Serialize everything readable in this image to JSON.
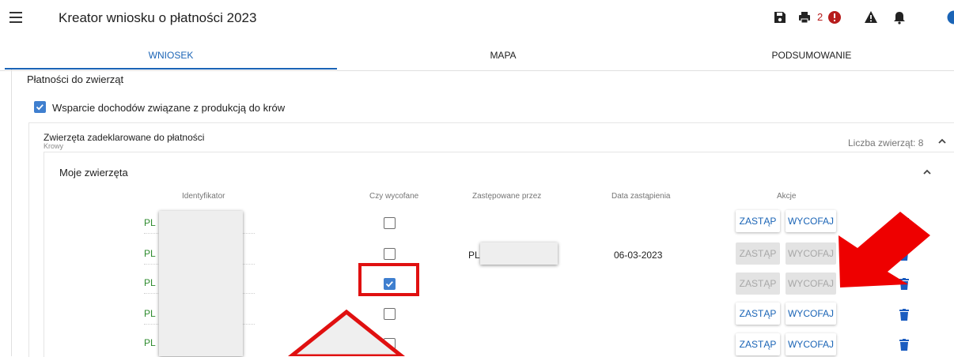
{
  "header": {
    "title": "Kreator wniosku o płatności 2023",
    "error_count": "2",
    "accent": "#1a64b6",
    "error_color": "#b71c1c"
  },
  "tabs": [
    {
      "label": "WNIOSEK",
      "active": true
    },
    {
      "label": "MAPA",
      "active": false
    },
    {
      "label": "PODSUMOWANIE",
      "active": false
    }
  ],
  "section": {
    "title": "Płatności do zwierząt",
    "support_checkbox_label": "Wsparcie dochodów związane z produkcją do krów",
    "support_checked": true
  },
  "declared": {
    "title": "Zwierzęta zadeklarowane do płatności",
    "subtitle": "Krowy",
    "count_label": "Liczba zwierząt: 8"
  },
  "my_animals": {
    "title": "Moje zwierzęta",
    "columns": [
      "Identyfikator",
      "Czy wycofane",
      "Zastępowane przez",
      "Data zastąpienia",
      "Akcje"
    ],
    "rows": [
      {
        "id": "PL",
        "withdrawn": false,
        "replaced_by": "",
        "date": "",
        "actions_enabled": true
      },
      {
        "id": "PL",
        "withdrawn": false,
        "replaced_by": "PL",
        "date": "06-03-2023",
        "actions_enabled": false
      },
      {
        "id": "PL",
        "withdrawn": true,
        "replaced_by": "",
        "date": "",
        "actions_enabled": false
      },
      {
        "id": "PL",
        "withdrawn": false,
        "replaced_by": "",
        "date": "",
        "actions_enabled": true
      },
      {
        "id": "PL",
        "withdrawn": false,
        "replaced_by": "",
        "date": "",
        "actions_enabled": true
      }
    ],
    "replace_label": "ZASTĄP",
    "withdraw_label": "WYCOFAJ"
  },
  "annotation_color": "#e01010"
}
